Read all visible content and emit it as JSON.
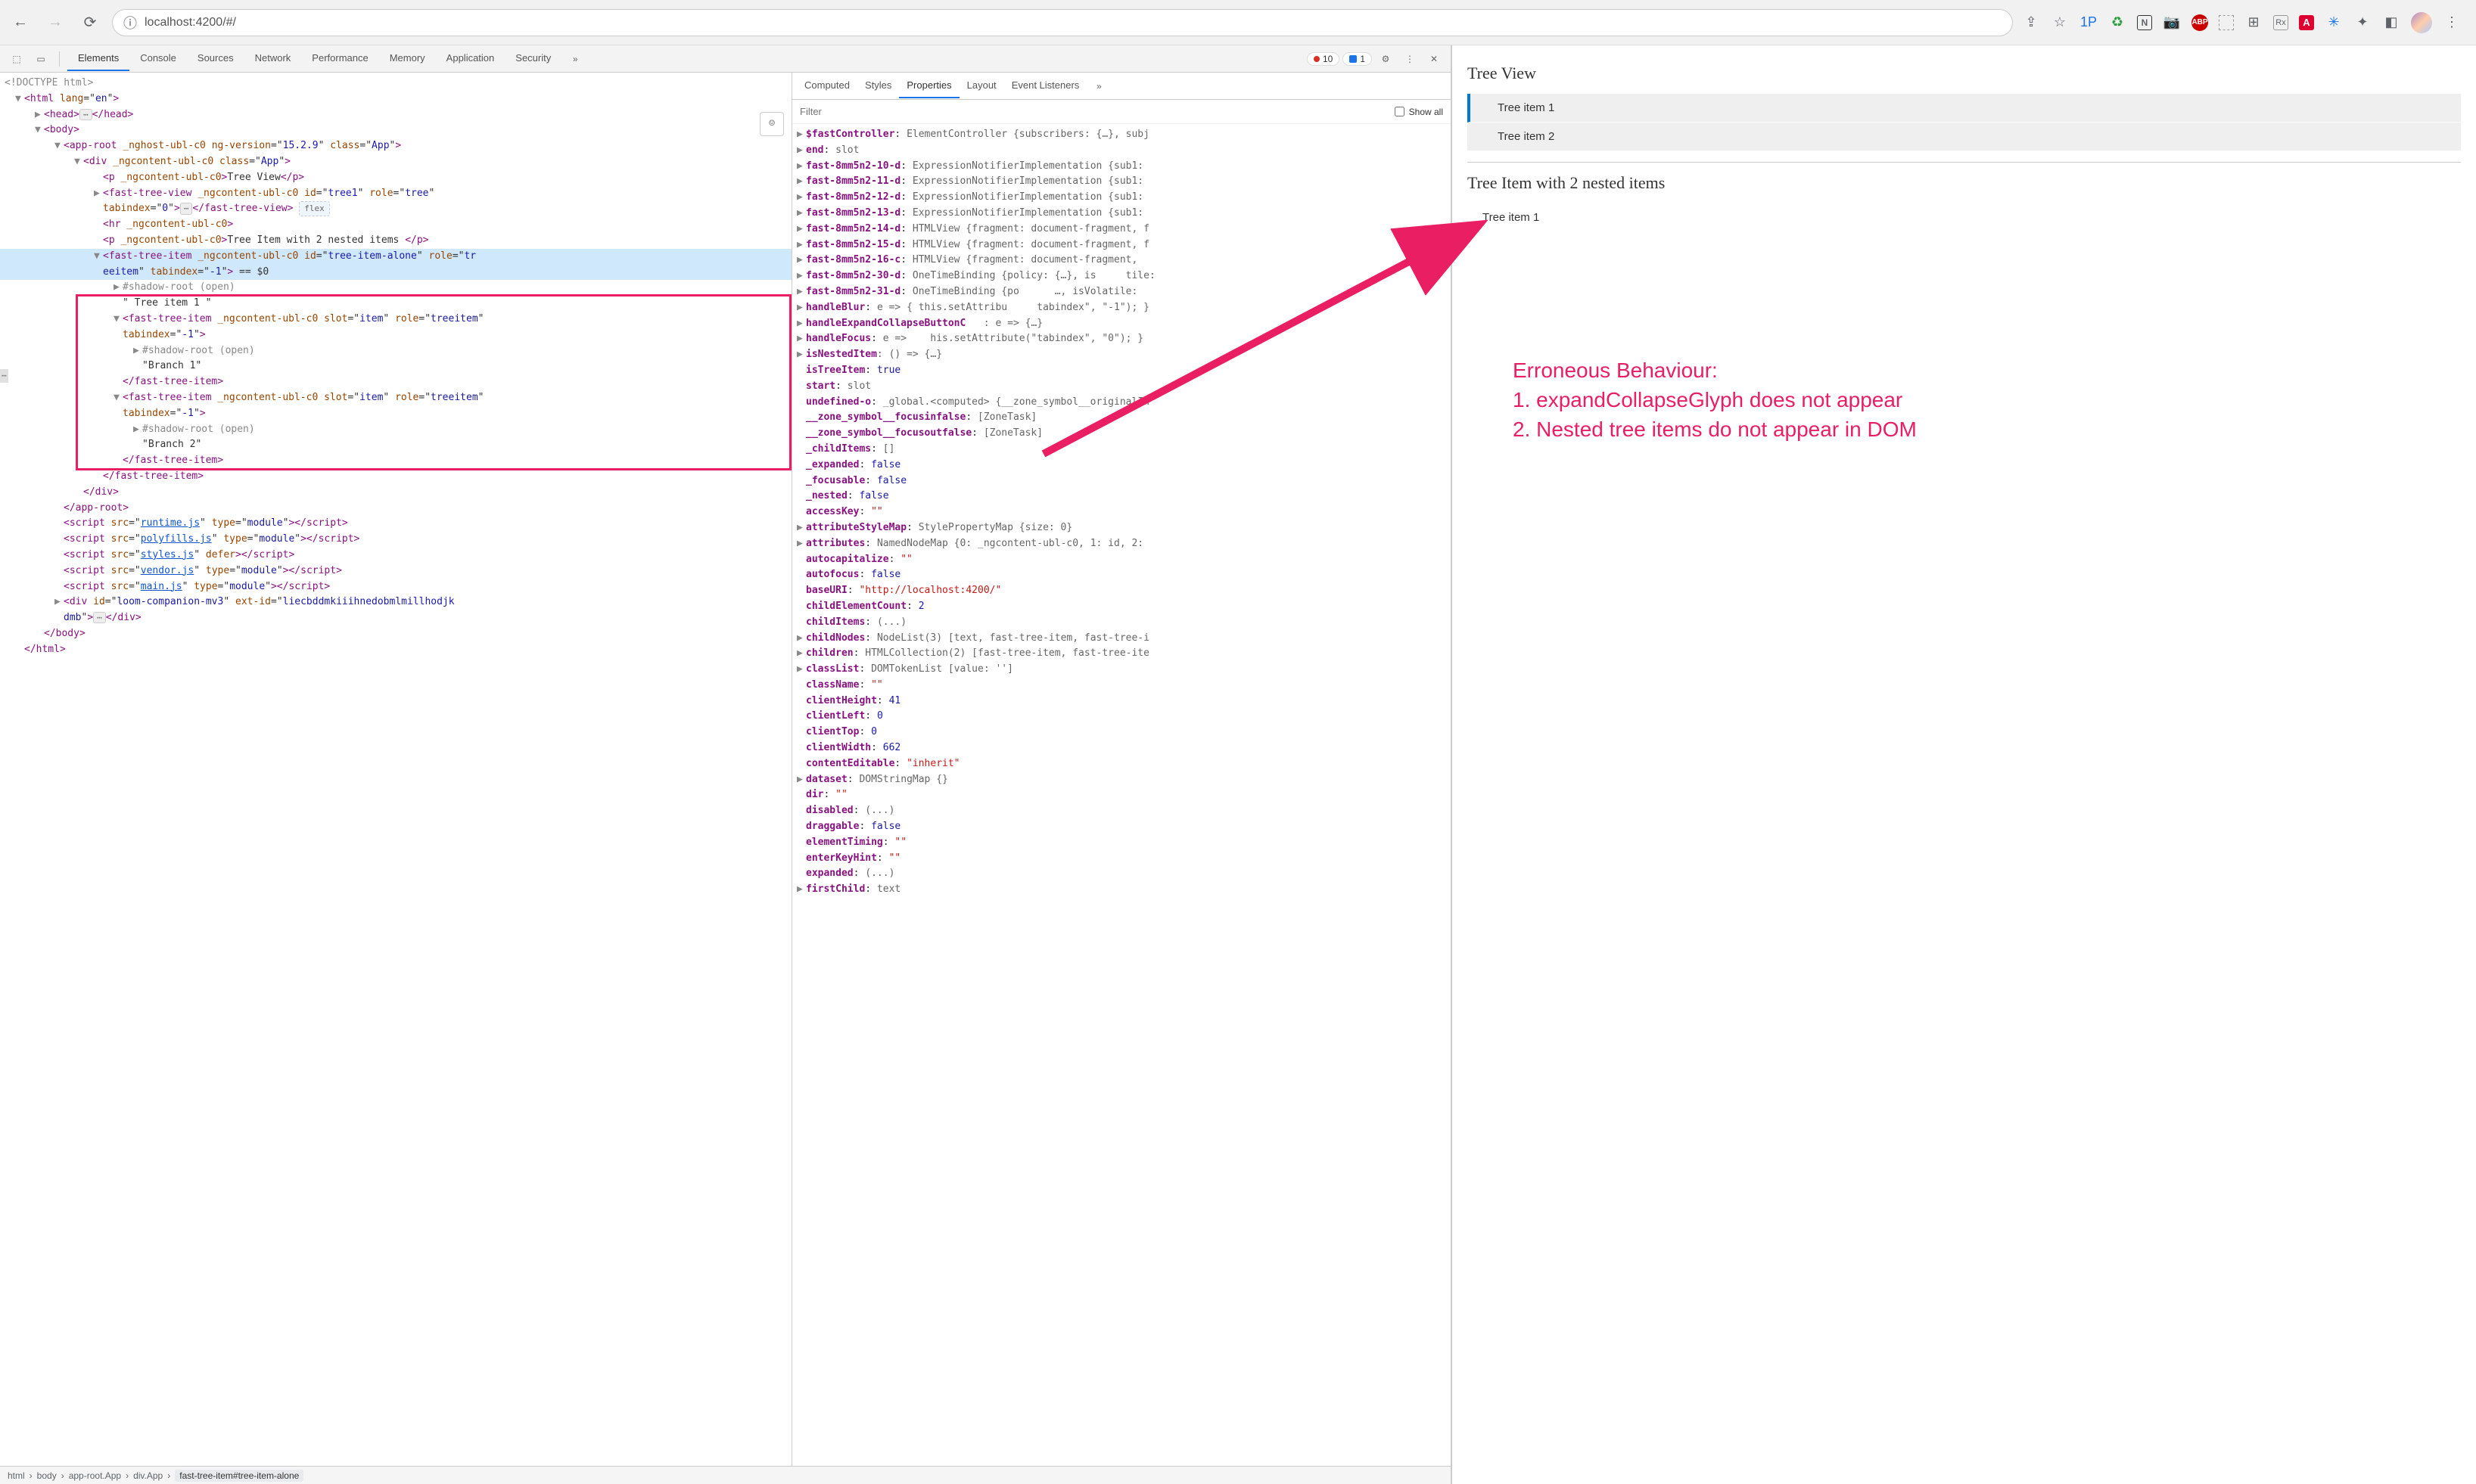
{
  "browser": {
    "url": "localhost:4200/#/",
    "back_icon": "←",
    "forward_icon": "→",
    "reload_icon": "⟳",
    "info_icon": "ⓘ",
    "share_icon": "⇪",
    "star_icon": "☆",
    "ext_labels": [
      "1P",
      "♻",
      "N",
      "📷",
      "ABP",
      "",
      "⊞",
      "Rx",
      "A",
      "✳",
      "✦",
      "◧"
    ]
  },
  "devtools": {
    "select_icon": "⬚",
    "device_icon": "▭",
    "tabs": [
      "Elements",
      "Console",
      "Sources",
      "Network",
      "Performance",
      "Memory",
      "Application",
      "Security"
    ],
    "active_tab": "Elements",
    "more_icon": "»",
    "error_count": "10",
    "info_count": "1",
    "gear_icon": "⚙",
    "kebab_icon": "⋮",
    "close_icon": "✕",
    "acc_icon": "☺",
    "flex_label": "flex",
    "dots_label": "⋯",
    "eq0": "== $0"
  },
  "dom": {
    "doctype": "<!DOCTYPE html>",
    "lines": [
      {
        "indent": 0,
        "arw": "▼",
        "html": "<span class='tag'>&lt;html</span> <span class='attr'>lang</span>=\"<span class='val'>en</span>\"<span class='tag'>&gt;</span>"
      },
      {
        "indent": 1,
        "arw": "▶",
        "html": "<span class='tag'>&lt;head&gt;</span><span class='dots-box'>⋯</span><span class='tag'>&lt;/head&gt;</span>"
      },
      {
        "indent": 1,
        "arw": "▼",
        "html": "<span class='tag'>&lt;body&gt;</span>"
      },
      {
        "indent": 2,
        "arw": "▼",
        "html": "<span class='tag'>&lt;app-root</span> <span class='attr'>_nghost-ubl-c0</span> <span class='attr'>ng-version</span>=\"<span class='val'>15.2.9</span>\" <span class='attr'>class</span>=\"<span class='val'>App</span>\"<span class='tag'>&gt;</span>"
      },
      {
        "indent": 3,
        "arw": "▼",
        "html": "<span class='tag'>&lt;div</span> <span class='attr'>_ngcontent-ubl-c0</span> <span class='attr'>class</span>=\"<span class='val'>App</span>\"<span class='tag'>&gt;</span>"
      },
      {
        "indent": 4,
        "arw": "",
        "html": "<span class='tag'>&lt;p</span> <span class='attr'>_ngcontent-ubl-c0</span><span class='tag'>&gt;</span><span class='txt'>Tree View</span><span class='tag'>&lt;/p&gt;</span>"
      },
      {
        "indent": 4,
        "arw": "▶",
        "html": "<span class='tag'>&lt;fast-tree-view</span> <span class='attr'>_ngcontent-ubl-c0</span> <span class='attr'>id</span>=\"<span class='val'>tree1</span>\" <span class='attr'>role</span>=\"<span class='val'>tree</span>\""
      },
      {
        "indent": 4,
        "arw": "",
        "html": "<span class='attr'>tabindex</span>=\"<span class='val'>0</span>\"<span class='tag'>&gt;</span><span class='dots-box'>⋯</span><span class='tag'>&lt;/fast-tree-view&gt;</span> <span class='flex-pill'>flex</span>"
      },
      {
        "indent": 4,
        "arw": "",
        "html": "<span class='tag'>&lt;hr</span> <span class='attr'>_ngcontent-ubl-c0</span><span class='tag'>&gt;</span>"
      },
      {
        "indent": 4,
        "arw": "",
        "html": "<span class='tag'>&lt;p</span> <span class='attr'>_ngcontent-ubl-c0</span><span class='tag'>&gt;</span><span class='txt'>Tree Item with 2 nested items </span><span class='tag'>&lt;/p&gt;</span>"
      },
      {
        "indent": 4,
        "arw": "▼",
        "hl": true,
        "html": "<span class='tag'>&lt;fast-tree-item</span> <span class='attr'>_ngcontent-ubl-c0</span> <span class='attr'>id</span>=\"<span class='val'>tree-item-alone</span>\" <span class='attr'>role</span>=\"<span class='val'>tr</span>"
      },
      {
        "indent": 4,
        "arw": "",
        "hl": true,
        "html": "<span class='val'>eeitem</span>\" <span class='attr'>tabindex</span>=\"<span class='val'>-1</span>\"<span class='tag'>&gt;</span> <span class='eq0'>== $0</span>"
      },
      {
        "indent": 5,
        "arw": "▶",
        "html": "<span class='gray'>#shadow-root (open)</span>"
      },
      {
        "indent": 5,
        "arw": "",
        "html": "<span class='txt'>\" Tree item 1 \"</span>"
      },
      {
        "indent": 5,
        "arw": "▼",
        "box": true,
        "html": "<span class='tag'>&lt;fast-tree-item</span> <span class='attr'>_ngcontent-ubl-c0</span> <span class='attr'>slot</span>=\"<span class='val'>item</span>\" <span class='attr'>role</span>=\"<span class='val'>treeitem</span>\""
      },
      {
        "indent": 5,
        "arw": "",
        "html": "<span class='attr'>tabindex</span>=\"<span class='val'>-1</span>\"<span class='tag'>&gt;</span>"
      },
      {
        "indent": 6,
        "arw": "▶",
        "html": "<span class='gray'>#shadow-root (open)</span>"
      },
      {
        "indent": 6,
        "arw": "",
        "html": "<span class='txt'>\"Branch 1\"</span>"
      },
      {
        "indent": 5,
        "arw": "",
        "html": "<span class='tag'>&lt;/fast-tree-item&gt;</span>"
      },
      {
        "indent": 5,
        "arw": "▼",
        "html": "<span class='tag'>&lt;fast-tree-item</span> <span class='attr'>_ngcontent-ubl-c0</span> <span class='attr'>slot</span>=\"<span class='val'>item</span>\" <span class='attr'>role</span>=\"<span class='val'>treeitem</span>\""
      },
      {
        "indent": 5,
        "arw": "",
        "html": "<span class='attr'>tabindex</span>=\"<span class='val'>-1</span>\"<span class='tag'>&gt;</span>"
      },
      {
        "indent": 6,
        "arw": "▶",
        "html": "<span class='gray'>#shadow-root (open)</span>"
      },
      {
        "indent": 6,
        "arw": "",
        "html": "<span class='txt'>\"Branch 2\"</span>"
      },
      {
        "indent": 5,
        "arw": "",
        "html": "<span class='tag'>&lt;/fast-tree-item&gt;</span>"
      },
      {
        "indent": 4,
        "arw": "",
        "boxend": true,
        "html": "<span class='tag'>&lt;/fast-tree-item&gt;</span>"
      },
      {
        "indent": 3,
        "arw": "",
        "html": "<span class='tag'>&lt;/div&gt;</span>"
      },
      {
        "indent": 2,
        "arw": "",
        "html": "<span class='tag'>&lt;/app-root&gt;</span>"
      },
      {
        "indent": 2,
        "arw": "",
        "html": "<span class='tag'>&lt;script</span> <span class='attr'>src</span>=\"<span class='link'>runtime.js</span>\" <span class='attr'>type</span>=\"<span class='val'>module</span>\"<span class='tag'>&gt;&lt;/script&gt;</span>"
      },
      {
        "indent": 2,
        "arw": "",
        "html": "<span class='tag'>&lt;script</span> <span class='attr'>src</span>=\"<span class='link'>polyfills.js</span>\" <span class='attr'>type</span>=\"<span class='val'>module</span>\"<span class='tag'>&gt;&lt;/script&gt;</span>"
      },
      {
        "indent": 2,
        "arw": "",
        "html": "<span class='tag'>&lt;script</span> <span class='attr'>src</span>=\"<span class='link'>styles.js</span>\" <span class='attr'>defer</span><span class='tag'>&gt;&lt;/script&gt;</span>"
      },
      {
        "indent": 2,
        "arw": "",
        "html": "<span class='tag'>&lt;script</span> <span class='attr'>src</span>=\"<span class='link'>vendor.js</span>\" <span class='attr'>type</span>=\"<span class='val'>module</span>\"<span class='tag'>&gt;&lt;/script&gt;</span>"
      },
      {
        "indent": 2,
        "arw": "",
        "html": "<span class='tag'>&lt;script</span> <span class='attr'>src</span>=\"<span class='link'>main.js</span>\" <span class='attr'>type</span>=\"<span class='val'>module</span>\"<span class='tag'>&gt;&lt;/script&gt;</span>"
      },
      {
        "indent": 2,
        "arw": "▶",
        "html": "<span class='tag'>&lt;div</span> <span class='attr'>id</span>=\"<span class='val'>loom-companion-mv3</span>\" <span class='attr'>ext-id</span>=\"<span class='val'>liecbddmkiiihnedobmlmillhodjk</span>"
      },
      {
        "indent": 2,
        "arw": "",
        "html": "<span class='val'>dmb</span>\"<span class='tag'>&gt;</span><span class='dots-box'>⋯</span><span class='tag'>&lt;/div&gt;</span>"
      },
      {
        "indent": 1,
        "arw": "",
        "html": "<span class='tag'>&lt;/body&gt;</span>"
      },
      {
        "indent": 0,
        "arw": "",
        "html": "<span class='tag'>&lt;/html&gt;</span>"
      }
    ]
  },
  "props": {
    "tabs": [
      "Computed",
      "Styles",
      "Properties",
      "Layout",
      "Event Listeners"
    ],
    "active_tab": "Properties",
    "more_icon": "»",
    "filter_placeholder": "Filter",
    "showall_label": "Show all",
    "items": [
      {
        "arw": "▶",
        "k": "$fastController",
        "v": ": <span class='pv-gray'>ElementController {subscribers: {…}, subj</span>"
      },
      {
        "arw": "▶",
        "k": "end",
        "v": ": <span class='pv-gray'>slot</span>"
      },
      {
        "arw": "▶",
        "k": "fast-8mm5n2-10-d",
        "v": ": <span class='pv-gray'>ExpressionNotifierImplementation {sub1:</span>"
      },
      {
        "arw": "▶",
        "k": "fast-8mm5n2-11-d",
        "v": ": <span class='pv-gray'>ExpressionNotifierImplementation {sub1:</span>"
      },
      {
        "arw": "▶",
        "k": "fast-8mm5n2-12-d",
        "v": ": <span class='pv-gray'>ExpressionNotifierImplementation {sub1:</span>"
      },
      {
        "arw": "▶",
        "k": "fast-8mm5n2-13-d",
        "v": ": <span class='pv-gray'>ExpressionNotifierImplementation {sub1:</span>"
      },
      {
        "arw": "▶",
        "k": "fast-8mm5n2-14-d",
        "v": ": <span class='pv-gray'>HTMLView {fragment: document-fragment, f</span>"
      },
      {
        "arw": "▶",
        "k": "fast-8mm5n2-15-d",
        "v": ": <span class='pv-gray'>HTMLView {fragment: document-fragment, f</span>"
      },
      {
        "arw": "▶",
        "k": "fast-8mm5n2-16-c",
        "v": ": <span class='pv-gray'>HTMLView {fragment: document-fragment,</span>"
      },
      {
        "arw": "▶",
        "k": "fast-8mm5n2-30-d",
        "v": ": <span class='pv-gray'>OneTimeBinding {policy: {…}, is&nbsp;&nbsp;&nbsp;&nbsp;&nbsp;tile:</span>"
      },
      {
        "arw": "▶",
        "k": "fast-8mm5n2-31-d",
        "v": ": <span class='pv-gray'>OneTimeBinding {po&nbsp;&nbsp;&nbsp;&nbsp;&nbsp;&nbsp;…, isVolatile:</span>"
      },
      {
        "arw": "▶",
        "k": "handleBlur",
        "v": ": <span class='pv-gray'>e =&gt; { this.setAttribu&nbsp;&nbsp;&nbsp;&nbsp;&nbsp;tabindex\", \"-1\"); }</span>"
      },
      {
        "arw": "▶",
        "k": "handleExpandCollapseButtonC",
        "v": "<span class='pv-gray'>&nbsp;&nbsp;&nbsp;: e =&gt; {…}</span>"
      },
      {
        "arw": "▶",
        "k": "handleFocus",
        "v": ": <span class='pv-gray'>e =&gt;&nbsp;&nbsp;&nbsp;&nbsp;his.setAttribute(\"tabindex\", \"0\"); }</span>"
      },
      {
        "arw": "▶",
        "k": "isNestedItem",
        "v": "<span class='pv-gray'>: () =&gt; {…}</span>"
      },
      {
        "arw": "",
        "k": "isTreeItem",
        "v": ": <span class='pv-bool'>true</span>"
      },
      {
        "arw": "",
        "k": "start",
        "v": ": <span class='pv-gray'>slot</span>"
      },
      {
        "arw": "",
        "k": "undefined-o",
        "v": ": <span class='pv-gray'>_global.&lt;computed&gt; {__zone_symbol__originalIn</span>"
      },
      {
        "arw": "",
        "k": "__zone_symbol__focusinfalse",
        "v": ": <span class='pv-gray'>[ZoneTask]</span>"
      },
      {
        "arw": "",
        "k": "__zone_symbol__focusoutfalse",
        "v": ": <span class='pv-gray'>[ZoneTask]</span>"
      },
      {
        "arw": "",
        "k": "_childItems",
        "v": ": <span class='pv-gray'>[]</span>"
      },
      {
        "arw": "",
        "k": "_expanded",
        "v": ": <span class='pv-bool'>false</span>"
      },
      {
        "arw": "",
        "k": "_focusable",
        "v": ": <span class='pv-bool'>false</span>"
      },
      {
        "arw": "",
        "k": "_nested",
        "v": ": <span class='pv-bool'>false</span>"
      },
      {
        "arw": "",
        "k": "accessKey",
        "v": ": <span class='pv-str'>\"\"</span>"
      },
      {
        "arw": "▶",
        "k": "attributeStyleMap",
        "v": ": <span class='pv-gray'>StylePropertyMap {size: 0}</span>"
      },
      {
        "arw": "▶",
        "k": "attributes",
        "v": ": <span class='pv-gray'>NamedNodeMap {0: _ngcontent-ubl-c0, 1: id, 2:</span>"
      },
      {
        "arw": "",
        "k": "autocapitalize",
        "v": ": <span class='pv-str'>\"\"</span>"
      },
      {
        "arw": "",
        "k": "autofocus",
        "v": ": <span class='pv-bool'>false</span>"
      },
      {
        "arw": "",
        "k": "baseURI",
        "v": ": <span class='pv-str'>\"http://localhost:4200/\"</span>"
      },
      {
        "arw": "",
        "k": "childElementCount",
        "v": ": <span class='pv-blue'>2</span>"
      },
      {
        "arw": "",
        "k": "childItems",
        "v": ": <span class='pv-gray'>(...)</span>"
      },
      {
        "arw": "▶",
        "k": "childNodes",
        "v": ": <span class='pv-gray'>NodeList(3) [text, fast-tree-item, fast-tree-i</span>"
      },
      {
        "arw": "▶",
        "k": "children",
        "v": ": <span class='pv-gray'>HTMLCollection(2) [fast-tree-item, fast-tree-ite</span>"
      },
      {
        "arw": "▶",
        "k": "classList",
        "v": ": <span class='pv-gray'>DOMTokenList [value: '']</span>"
      },
      {
        "arw": "",
        "k": "className",
        "v": ": <span class='pv-str'>\"\"</span>"
      },
      {
        "arw": "",
        "k": "clientHeight",
        "v": ": <span class='pv-blue'>41</span>"
      },
      {
        "arw": "",
        "k": "clientLeft",
        "v": ": <span class='pv-blue'>0</span>"
      },
      {
        "arw": "",
        "k": "clientTop",
        "v": ": <span class='pv-blue'>0</span>"
      },
      {
        "arw": "",
        "k": "clientWidth",
        "v": ": <span class='pv-blue'>662</span>"
      },
      {
        "arw": "",
        "k": "contentEditable",
        "v": ": <span class='pv-str'>\"inherit\"</span>"
      },
      {
        "arw": "▶",
        "k": "dataset",
        "v": ": <span class='pv-gray'>DOMStringMap {}</span>"
      },
      {
        "arw": "",
        "k": "dir",
        "v": ": <span class='pv-str'>\"\"</span>"
      },
      {
        "arw": "",
        "k": "disabled",
        "v": ": <span class='pv-gray'>(...)</span>"
      },
      {
        "arw": "",
        "k": "draggable",
        "v": ": <span class='pv-bool'>false</span>"
      },
      {
        "arw": "",
        "k": "elementTiming",
        "v": ": <span class='pv-str'>\"\"</span>"
      },
      {
        "arw": "",
        "k": "enterKeyHint",
        "v": ": <span class='pv-str'>\"\"</span>"
      },
      {
        "arw": "",
        "k": "expanded",
        "v": ": <span class='pv-gray'>(...)</span>"
      },
      {
        "arw": "▶",
        "k": "firstChild",
        "v": ": <span class='pv-gray'>text</span>"
      }
    ]
  },
  "breadcrumb": [
    "html",
    "body",
    "app-root.App",
    "div.App",
    "fast-tree-item#tree-item-alone"
  ],
  "app": {
    "heading1": "Tree View",
    "tree1_item1": "Tree item 1",
    "tree1_item2": "Tree item 2",
    "heading2": "Tree Item with 2 nested items",
    "tree2_item1": "Tree item 1",
    "anno_title": "Erroneous Behaviour:",
    "anno_line1": "1. expandCollapseGlyph does not appear",
    "anno_line2": "2. Nested tree items do not appear in DOM"
  }
}
